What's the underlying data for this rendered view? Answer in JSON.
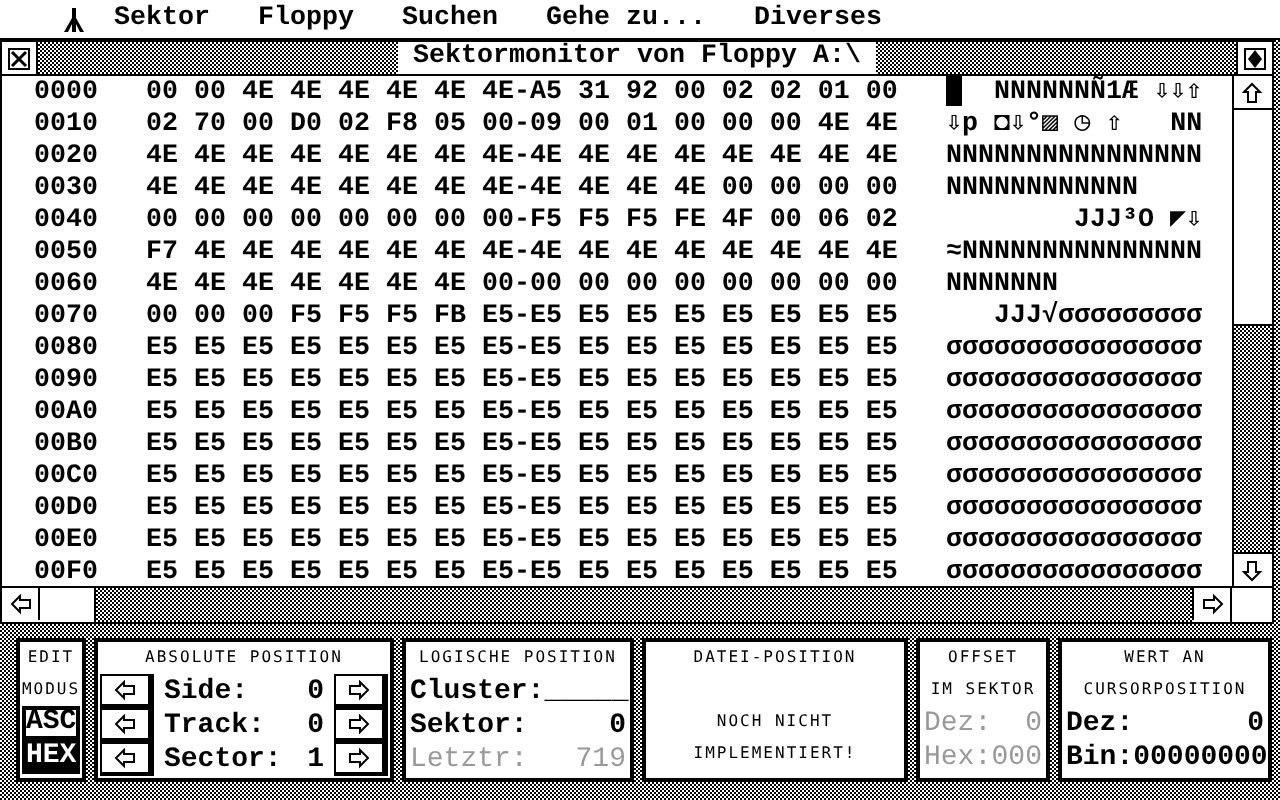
{
  "menu": {
    "items": [
      "Sektor",
      "Floppy",
      "Suchen",
      "Gehe zu...",
      "Diverses"
    ]
  },
  "window": {
    "title": "Sektormonitor von Floppy A:\\"
  },
  "rows": [
    {
      "address": "0000",
      "hex": "00 00 4E 4E 4E 4E 4E 4E-A5 31 92 00 02 02 01 00",
      "ascii": "█  NNNNNNÑ1Æ ⇩⇩⇧"
    },
    {
      "address": "0010",
      "hex": "02 70 00 D0 02 F8 05 00-09 00 01 00 00 00 4E 4E",
      "ascii": "⇩p ◘⇩°▨ ◷ ⇧   NN"
    },
    {
      "address": "0020",
      "hex": "4E 4E 4E 4E 4E 4E 4E 4E-4E 4E 4E 4E 4E 4E 4E 4E",
      "ascii": "NNNNNNNNNNNNNNNN"
    },
    {
      "address": "0030",
      "hex": "4E 4E 4E 4E 4E 4E 4E 4E-4E 4E 4E 4E 00 00 00 00",
      "ascii": "NNNNNNNNNNNN"
    },
    {
      "address": "0040",
      "hex": "00 00 00 00 00 00 00 00-F5 F5 F5 FE 4F 00 06 02",
      "ascii": "        JJJ³O ◤⇩"
    },
    {
      "address": "0050",
      "hex": "F7 4E 4E 4E 4E 4E 4E 4E-4E 4E 4E 4E 4E 4E 4E 4E",
      "ascii": "≈NNNNNNNNNNNNNNN"
    },
    {
      "address": "0060",
      "hex": "4E 4E 4E 4E 4E 4E 4E 00-00 00 00 00 00 00 00 00",
      "ascii": "NNNNNNN"
    },
    {
      "address": "0070",
      "hex": "00 00 00 F5 F5 F5 FB E5-E5 E5 E5 E5 E5 E5 E5 E5",
      "ascii": "   JJJ√σσσσσσσσσ"
    },
    {
      "address": "0080",
      "hex": "E5 E5 E5 E5 E5 E5 E5 E5-E5 E5 E5 E5 E5 E5 E5 E5",
      "ascii": "σσσσσσσσσσσσσσσσ"
    },
    {
      "address": "0090",
      "hex": "E5 E5 E5 E5 E5 E5 E5 E5-E5 E5 E5 E5 E5 E5 E5 E5",
      "ascii": "σσσσσσσσσσσσσσσσ"
    },
    {
      "address": "00A0",
      "hex": "E5 E5 E5 E5 E5 E5 E5 E5-E5 E5 E5 E5 E5 E5 E5 E5",
      "ascii": "σσσσσσσσσσσσσσσσ"
    },
    {
      "address": "00B0",
      "hex": "E5 E5 E5 E5 E5 E5 E5 E5-E5 E5 E5 E5 E5 E5 E5 E5",
      "ascii": "σσσσσσσσσσσσσσσσ"
    },
    {
      "address": "00C0",
      "hex": "E5 E5 E5 E5 E5 E5 E5 E5-E5 E5 E5 E5 E5 E5 E5 E5",
      "ascii": "σσσσσσσσσσσσσσσσ"
    },
    {
      "address": "00D0",
      "hex": "E5 E5 E5 E5 E5 E5 E5 E5-E5 E5 E5 E5 E5 E5 E5 E5",
      "ascii": "σσσσσσσσσσσσσσσσ"
    },
    {
      "address": "00E0",
      "hex": "E5 E5 E5 E5 E5 E5 E5 E5-E5 E5 E5 E5 E5 E5 E5 E5",
      "ascii": "σσσσσσσσσσσσσσσσ"
    },
    {
      "address": "00F0",
      "hex": "E5 E5 E5 E5 E5 E5 E5 E5-E5 E5 E5 E5 E5 E5 E5 E5",
      "ascii": "σσσσσσσσσσσσσσσσ"
    }
  ],
  "panels": {
    "edit_mode": {
      "labels": [
        "EDIT",
        "MODUS"
      ],
      "options": [
        {
          "label": "ASC",
          "selected": false
        },
        {
          "label": "HEX",
          "selected": true
        }
      ]
    },
    "absolute": {
      "title": "ABSOLUTE POSITION",
      "fields": [
        {
          "label": "Side:",
          "value": "0"
        },
        {
          "label": "Track:",
          "value": "0"
        },
        {
          "label": "Sector:",
          "value": "1"
        }
      ]
    },
    "logical": {
      "title": "LOGISCHE POSITION",
      "fields": [
        {
          "label": "Cluster:",
          "value": "_____",
          "disabled": false
        },
        {
          "label": "Sektor:",
          "value": "0",
          "disabled": false
        },
        {
          "label": "Letztr:",
          "value": "719",
          "disabled": true
        }
      ]
    },
    "file": {
      "title": "DATEI-POSITION",
      "message": [
        "NOCH NICHT",
        "IMPLEMENTIERT!"
      ]
    },
    "offset": {
      "title": [
        "OFFSET",
        "IM SEKTOR"
      ],
      "fields": [
        {
          "label": "Dez:",
          "value": "0",
          "disabled": true
        },
        {
          "label": "Hex:",
          "value": "000",
          "disabled": true
        }
      ]
    },
    "value": {
      "title": [
        "WERT AN",
        "CURSORPOSITION"
      ],
      "fields": [
        {
          "label": "Dez:",
          "value": "0",
          "disabled": false
        },
        {
          "label": "Bin:",
          "value": "00000000",
          "disabled": false
        }
      ]
    }
  }
}
